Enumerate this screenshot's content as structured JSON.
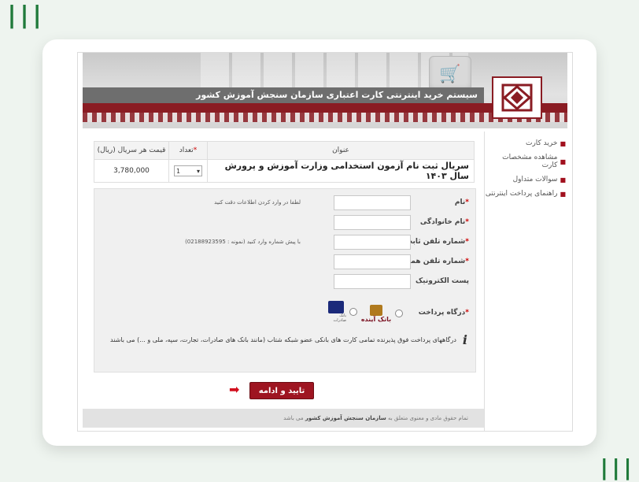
{
  "header": {
    "title": "سیستم خرید اینترنتی کارت اعتباری سازمان سنجش آموزش کشور"
  },
  "sidebar": {
    "items": [
      {
        "label": "خرید کارت"
      },
      {
        "label": "مشاهده مشخصات کارت"
      },
      {
        "label": "سوالات متداول"
      },
      {
        "label": "راهنمای پرداخت اینترنتی"
      }
    ]
  },
  "product_table": {
    "headers": {
      "title": "عنوان",
      "quantity": "تعداد",
      "price": "قیمت هر سریال (ریال)"
    },
    "row": {
      "title": "سریال ثبت نام آزمون استخدامی وزارت آموزش و پرورش سال ۱۴۰۳",
      "quantity": "1",
      "price": "3,780,000"
    }
  },
  "form": {
    "note": "لطفا در وارد کردن اطلاعات دقت کنید",
    "phone_hint": "با پیش شماره وارد کنید (نمونه : 02188923595)",
    "fields": {
      "first_name": {
        "label": "نام",
        "value": "",
        "placeholder": ""
      },
      "last_name": {
        "label": "نام خانوادگی",
        "value": "",
        "placeholder": ""
      },
      "phone": {
        "label": "شماره تلفن ثابت",
        "value": "",
        "placeholder": ""
      },
      "mobile": {
        "label": "شماره تلفن همراه",
        "value": "",
        "placeholder": ""
      },
      "email": {
        "label": "پست الکترونیک",
        "value": "",
        "placeholder": ""
      }
    },
    "gateway_label": "درگاه پرداخت",
    "gateways": {
      "ayandeh": {
        "name": "بانک آینده"
      },
      "saderat": {
        "name": "بانک صادرات"
      }
    },
    "info_text": "درگاههای پرداخت فوق پذیرنده تمامی کارت های بانکی عضو شبکه شتاب (مانند بانک های صادرات، تجارت، سپه، ملی و ...) می باشند"
  },
  "submit_label": "تایید و ادامه",
  "footer": {
    "prefix": "تمام حقوق مادی و معنوی متعلق به",
    "org": "سازمان سنجش آموزش کشور",
    "suffix": "می باشد"
  },
  "colors": {
    "brand": "#8a1c23",
    "button": "#9e1521",
    "arrow": "#d20f1e"
  }
}
